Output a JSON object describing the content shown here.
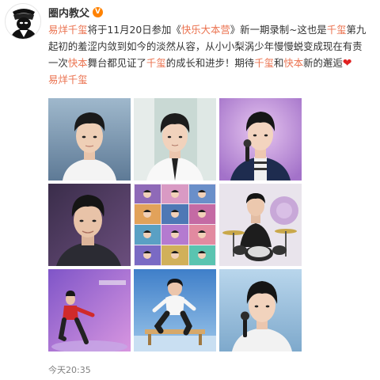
{
  "post": {
    "author": "圈内教父",
    "text_line1": [
      {
        "t": "易烊千玺",
        "hl": true
      },
      {
        "t": "将于11月20日参加《",
        "hl": false
      },
      {
        "t": "快乐大本营",
        "hl": true
      },
      {
        "t": "》新一期录制~这也是",
        "hl": false
      },
      {
        "t": "千玺",
        "hl": true
      },
      {
        "t": "第九",
        "hl": false
      }
    ],
    "text_line2": [
      {
        "t": "起初的羞涩内敛到如今的淡然从容，从小小梨涡少年慢慢蜕变成现在有责",
        "hl": false
      }
    ],
    "text_line3": [
      {
        "t": "一次",
        "hl": false
      },
      {
        "t": "快本",
        "hl": true
      },
      {
        "t": "舞台都见证了",
        "hl": false
      },
      {
        "t": "千玺",
        "hl": true
      },
      {
        "t": "的成长和进步！期待",
        "hl": false
      },
      {
        "t": "千玺",
        "hl": true
      },
      {
        "t": "和",
        "hl": false
      },
      {
        "t": "快本",
        "hl": true
      },
      {
        "t": "新的邂逅",
        "hl": false
      }
    ],
    "heart": "❤",
    "tag": "易烊千玺",
    "timestamp": "今天20:35"
  },
  "colors": {
    "highlight": "#eb7350",
    "text": "#333333",
    "meta": "#808080",
    "vip": "#ff8200"
  },
  "icons": {
    "verified": "vip-badge-icon",
    "heart": "heart-icon"
  }
}
